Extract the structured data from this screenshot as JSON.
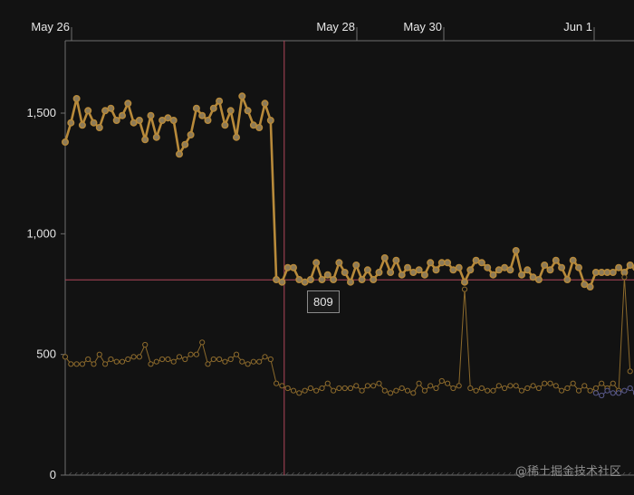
{
  "chart_data": {
    "type": "line",
    "x_ticks": [
      "May 26",
      "May 28",
      "May 30",
      "Jun 1"
    ],
    "y_ticks": [
      "0",
      "500",
      "1,000",
      "1,500"
    ],
    "ylim": [
      0,
      1800
    ],
    "grid": false,
    "crosshair": {
      "x_index": 36,
      "y": 809
    },
    "tooltip": "809",
    "series": [
      {
        "color": "#b88a3a",
        "stroke": "bold",
        "values": [
          1380,
          1460,
          1560,
          1450,
          1510,
          1460,
          1440,
          1510,
          1520,
          1470,
          1490,
          1540,
          1460,
          1470,
          1390,
          1490,
          1400,
          1470,
          1480,
          1470,
          1330,
          1370,
          1410,
          1520,
          1490,
          1470,
          1520,
          1550,
          1450,
          1510,
          1400,
          1570,
          1510,
          1450,
          1440,
          1540,
          1470,
          810,
          800,
          860,
          860,
          810,
          800,
          810,
          880,
          810,
          830,
          810,
          880,
          840,
          800,
          870,
          810,
          850,
          810,
          840,
          900,
          840,
          890,
          830,
          860,
          840,
          850,
          830,
          880,
          850,
          880,
          880,
          850,
          860,
          800,
          850,
          890,
          880,
          860,
          830,
          850,
          860,
          850,
          930,
          830,
          850,
          820,
          810,
          870,
          850,
          890,
          860,
          810,
          890,
          860,
          790,
          780,
          840,
          840,
          840,
          840,
          860,
          840,
          870,
          860
        ]
      },
      {
        "color": "#8c6a2c",
        "stroke": "thin",
        "values": [
          490,
          460,
          460,
          460,
          480,
          460,
          500,
          460,
          480,
          470,
          470,
          480,
          490,
          490,
          540,
          460,
          470,
          480,
          480,
          470,
          490,
          480,
          500,
          500,
          550,
          460,
          480,
          480,
          470,
          480,
          500,
          470,
          460,
          470,
          470,
          490,
          480,
          380,
          370,
          360,
          350,
          340,
          350,
          360,
          350,
          360,
          380,
          350,
          360,
          360,
          360,
          370,
          350,
          370,
          370,
          380,
          350,
          340,
          350,
          360,
          350,
          340,
          380,
          350,
          370,
          360,
          390,
          380,
          360,
          370,
          770,
          360,
          350,
          360,
          350,
          350,
          370,
          360,
          370,
          370,
          350,
          360,
          370,
          360,
          380,
          380,
          370,
          350,
          360,
          380,
          350,
          370,
          350,
          360,
          380,
          360,
          380,
          350,
          820,
          430
        ]
      },
      {
        "color": "#5a5a8c",
        "stroke": "thin",
        "values": [
          null,
          null,
          null,
          null,
          null,
          null,
          null,
          null,
          null,
          null,
          null,
          null,
          null,
          null,
          null,
          null,
          null,
          null,
          null,
          null,
          null,
          null,
          null,
          null,
          null,
          null,
          null,
          null,
          null,
          null,
          null,
          null,
          null,
          null,
          null,
          null,
          null,
          null,
          null,
          null,
          null,
          null,
          null,
          null,
          null,
          null,
          null,
          null,
          null,
          null,
          null,
          null,
          null,
          null,
          null,
          null,
          null,
          null,
          null,
          null,
          null,
          null,
          null,
          null,
          null,
          null,
          null,
          null,
          null,
          null,
          null,
          null,
          null,
          null,
          null,
          null,
          null,
          null,
          null,
          null,
          null,
          null,
          null,
          null,
          null,
          null,
          null,
          null,
          null,
          null,
          null,
          null,
          null,
          340,
          330,
          350,
          340,
          340,
          350,
          360,
          340
        ]
      }
    ]
  },
  "watermark": "@稀土掘金技术社区"
}
